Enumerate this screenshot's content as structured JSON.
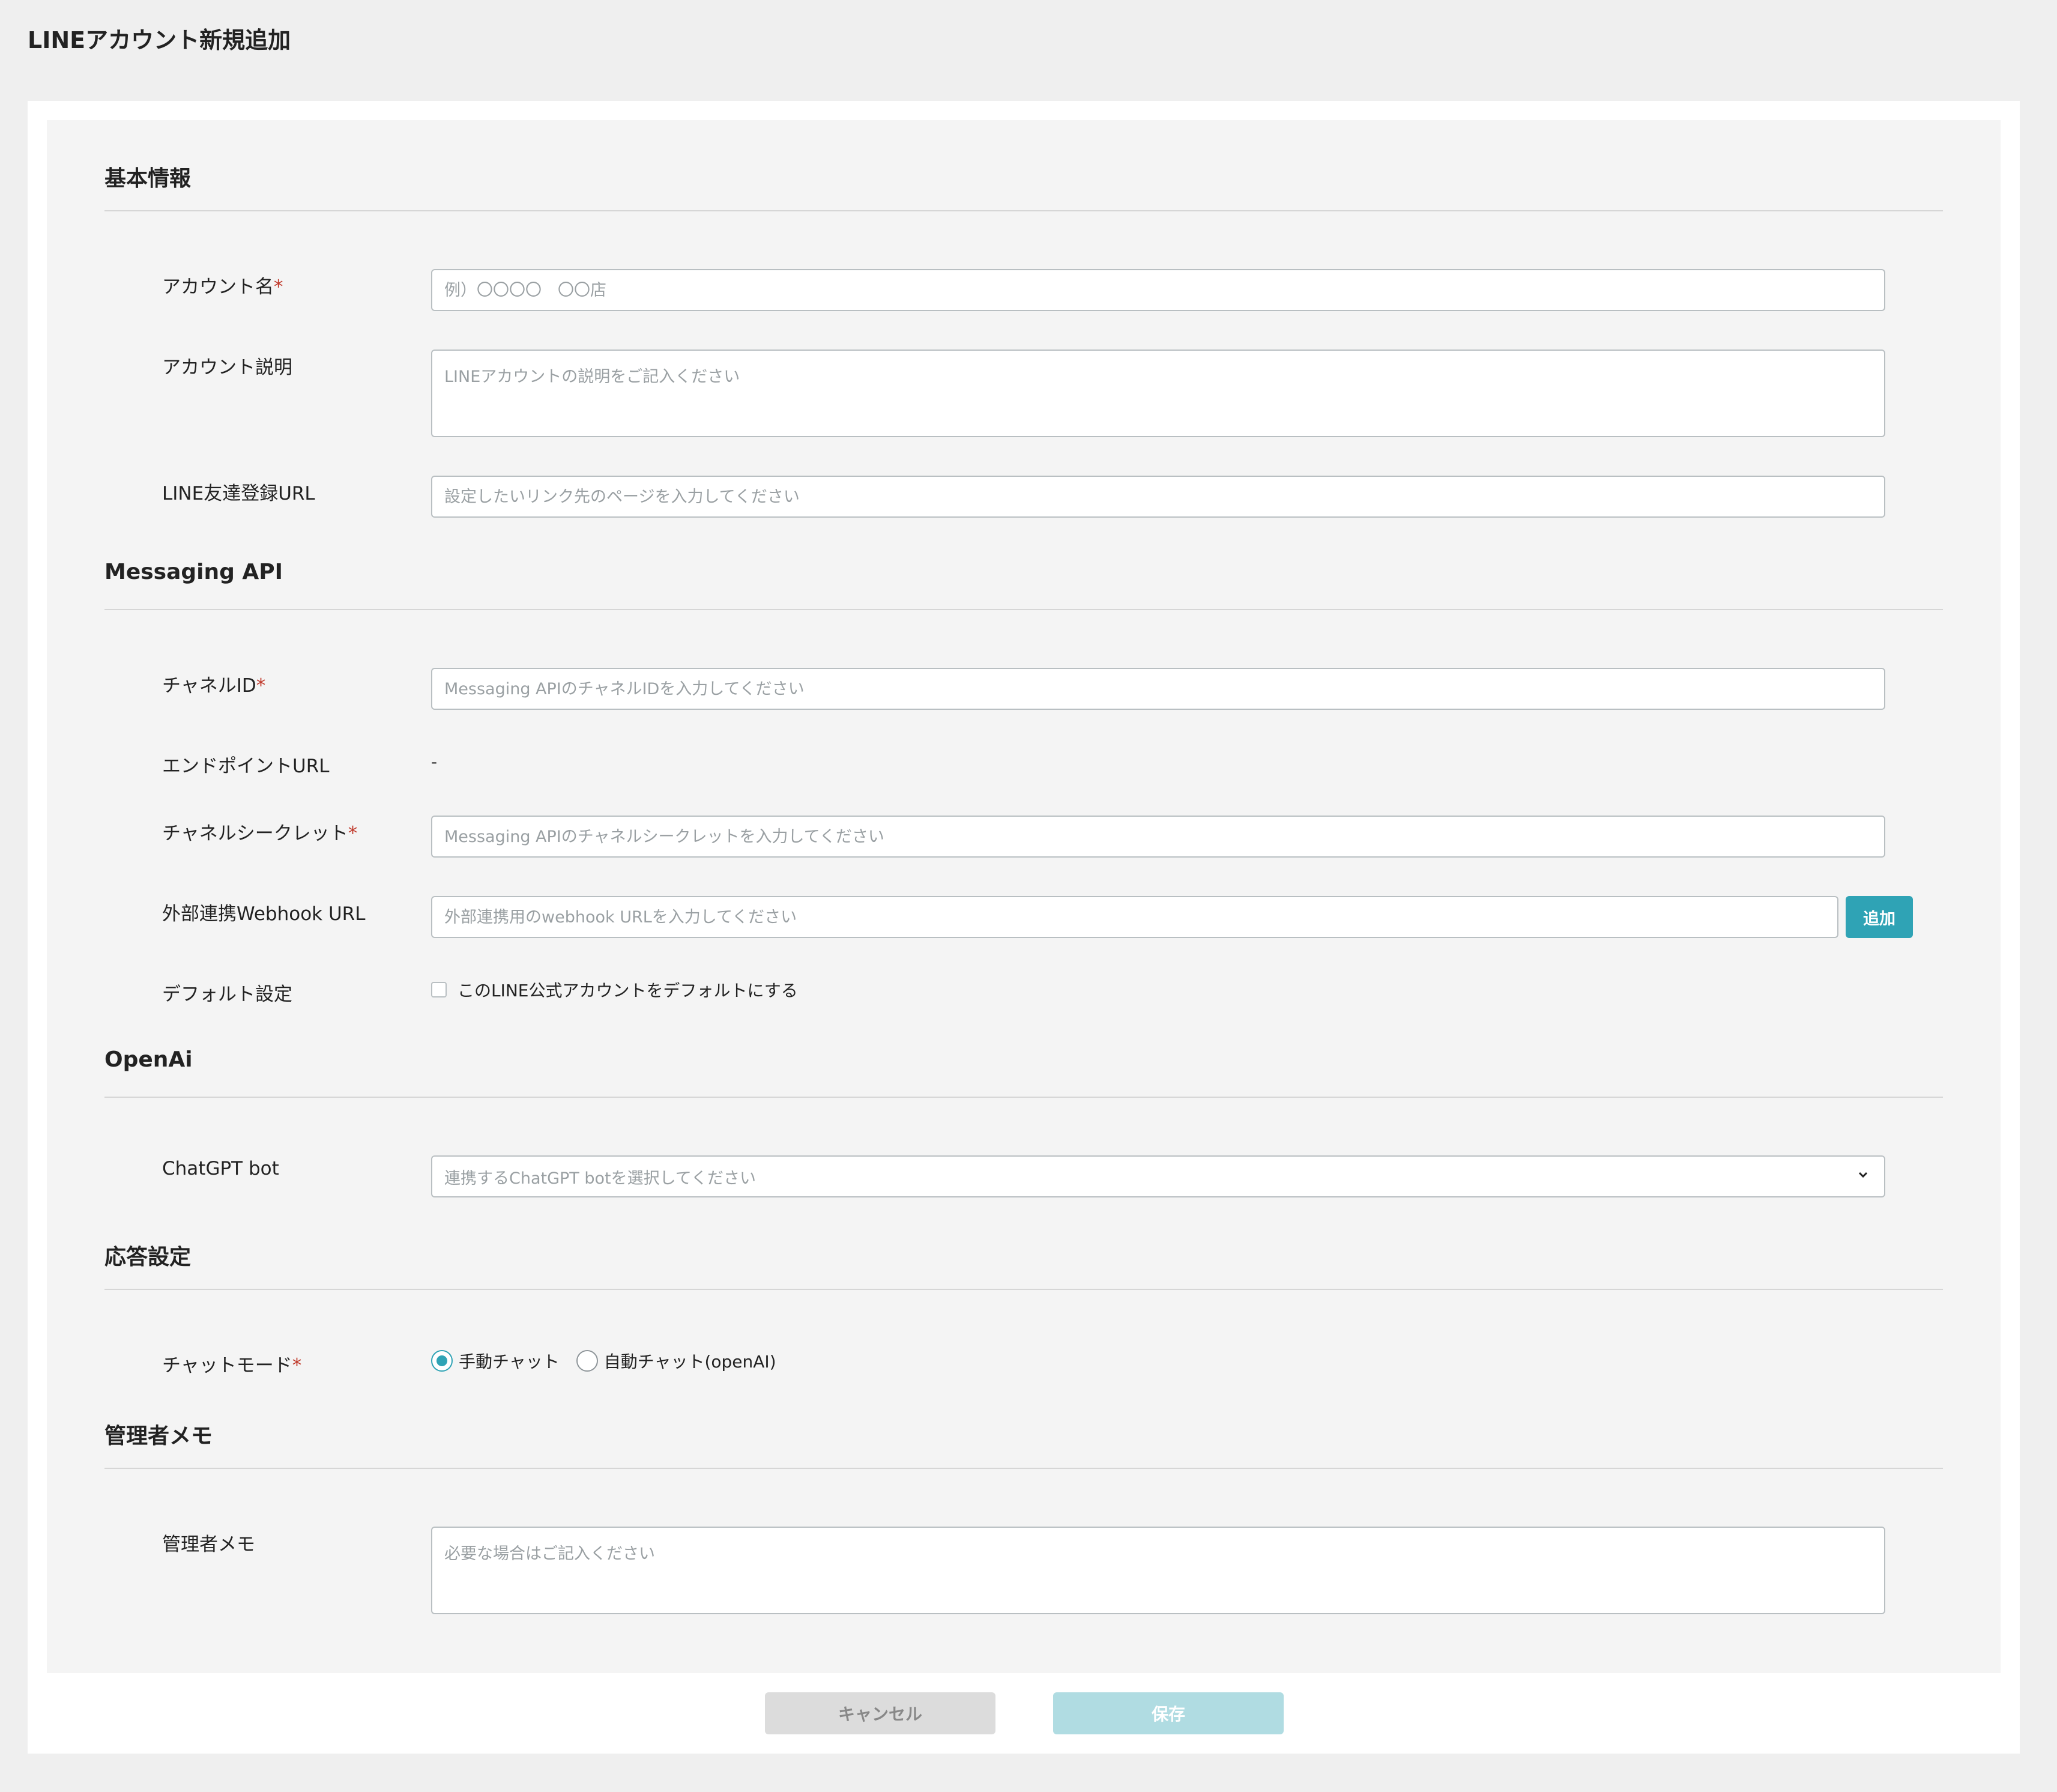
{
  "page": {
    "title": "LINEアカウント新規追加"
  },
  "sections": {
    "basic": {
      "title": "基本情報",
      "account_name": {
        "label": "アカウント名",
        "required": "*",
        "placeholder": "例）〇〇〇〇　〇〇店"
      },
      "account_desc": {
        "label": "アカウント説明",
        "placeholder": "LINEアカウントの説明をご記入ください"
      },
      "friend_url": {
        "label": "LINE友達登録URL",
        "placeholder": "設定したいリンク先のページを入力してください"
      }
    },
    "messaging": {
      "title": "Messaging API",
      "channel_id": {
        "label": "チャネルID",
        "required": "*",
        "placeholder": "Messaging APIのチャネルIDを入力してください"
      },
      "endpoint": {
        "label": "エンドポイントURL",
        "value": "-"
      },
      "channel_secret": {
        "label": "チャネルシークレット",
        "required": "*",
        "placeholder": "Messaging APIのチャネルシークレットを入力してください"
      },
      "webhook": {
        "label": "外部連携Webhook URL",
        "placeholder": "外部連携用のwebhook URLを入力してください",
        "add_label": "追加"
      },
      "default": {
        "label": "デフォルト設定",
        "checkbox_label": "このLINE公式アカウントをデフォルトにする"
      }
    },
    "openai": {
      "title": "OpenAi",
      "chatgpt": {
        "label": "ChatGPT bot",
        "placeholder": "連携するChatGPT botを選択してください"
      }
    },
    "response": {
      "title": "応答設定",
      "chat_mode": {
        "label": "チャットモード",
        "required": "*",
        "options": [
          "手動チャット",
          "自動チャット(openAI)"
        ],
        "selected": "手動チャット"
      }
    },
    "memo": {
      "title": "管理者メモ",
      "memo_field": {
        "label": "管理者メモ",
        "placeholder": "必要な場合はご記入ください"
      }
    }
  },
  "footer": {
    "cancel_label": "キャンセル",
    "save_label": "保存"
  },
  "colors": {
    "accent": "#2fa3b5",
    "required": "#c0392b",
    "save_disabled": "#b0dce2"
  }
}
